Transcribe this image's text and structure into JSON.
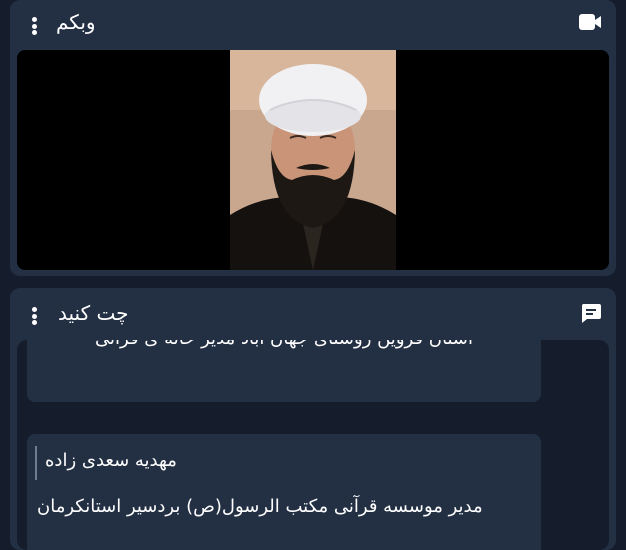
{
  "webcam": {
    "title": "وبکم",
    "header_icon": "video-camera-icon",
    "menu_icon": "kebab-menu-icon"
  },
  "chat": {
    "title": "چت کنید",
    "header_icon": "chat-bubble-icon",
    "menu_icon": "kebab-menu-icon",
    "messages": [
      {
        "sender": "",
        "text": "استان قزوین روستای جهان آباد مدیر خانه ی قرآنی"
      },
      {
        "sender": "مهدیه سعدی زاده",
        "text": "مدیر موسسه قرآنی مکتب الرسول(ص) بردسیر استانکرمان"
      }
    ]
  },
  "colors": {
    "page_bg": "#151c2b",
    "panel_bg": "#233044",
    "text": "#ffffff"
  }
}
